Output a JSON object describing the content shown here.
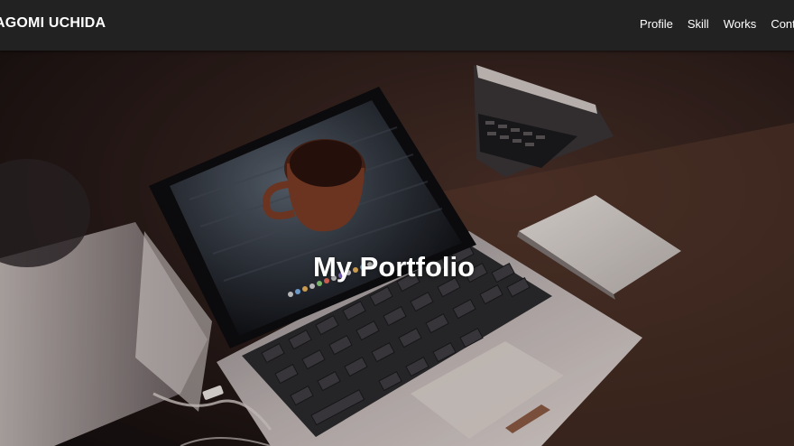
{
  "header": {
    "site_name": "AGOMI UCHIDA",
    "nav": [
      {
        "label": "Profile"
      },
      {
        "label": "Skill"
      },
      {
        "label": "Works"
      },
      {
        "label": "Contact"
      }
    ]
  },
  "hero": {
    "title": "My Portfolio"
  },
  "colors": {
    "header_bg": "#222222",
    "text": "#ffffff"
  }
}
